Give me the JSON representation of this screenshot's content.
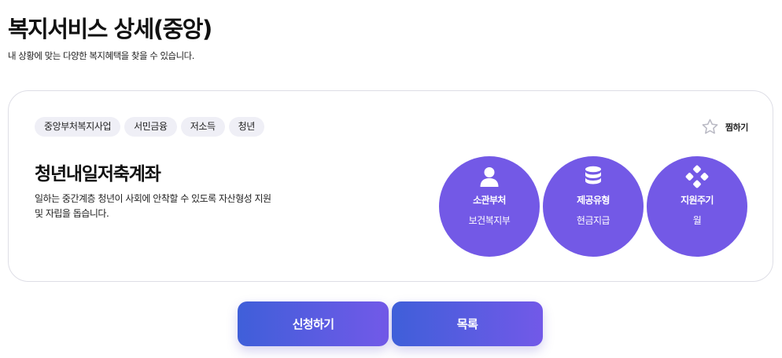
{
  "page": {
    "title": "복지서비스 상세(중앙)",
    "subtitle": "내 상황에 맞는 다양한 복지혜택을 찾을 수 있습니다."
  },
  "service": {
    "tags": [
      "중앙부처복지사업",
      "서민금융",
      "저소득",
      "청년"
    ],
    "favorite_label": "찜하기",
    "name": "청년내일저축계좌",
    "description": "일하는 중간계층 청년이 사회에 안착할 수 있도록 자산형성 지원 및 자립을 돕습니다.",
    "info": [
      {
        "icon": "person-icon",
        "title": "소관부처",
        "value": "보건복지부"
      },
      {
        "icon": "database-icon",
        "title": "제공유형",
        "value": "현금지급"
      },
      {
        "icon": "diamond-dots-icon",
        "title": "지원주기",
        "value": "월"
      }
    ]
  },
  "actions": {
    "apply_label": "신청하기",
    "list_label": "목록"
  },
  "colors": {
    "accent": "#7359e6",
    "gradient_start": "#3f5fd9",
    "gradient_end": "#7259e8",
    "tag_bg": "#efeff6"
  }
}
